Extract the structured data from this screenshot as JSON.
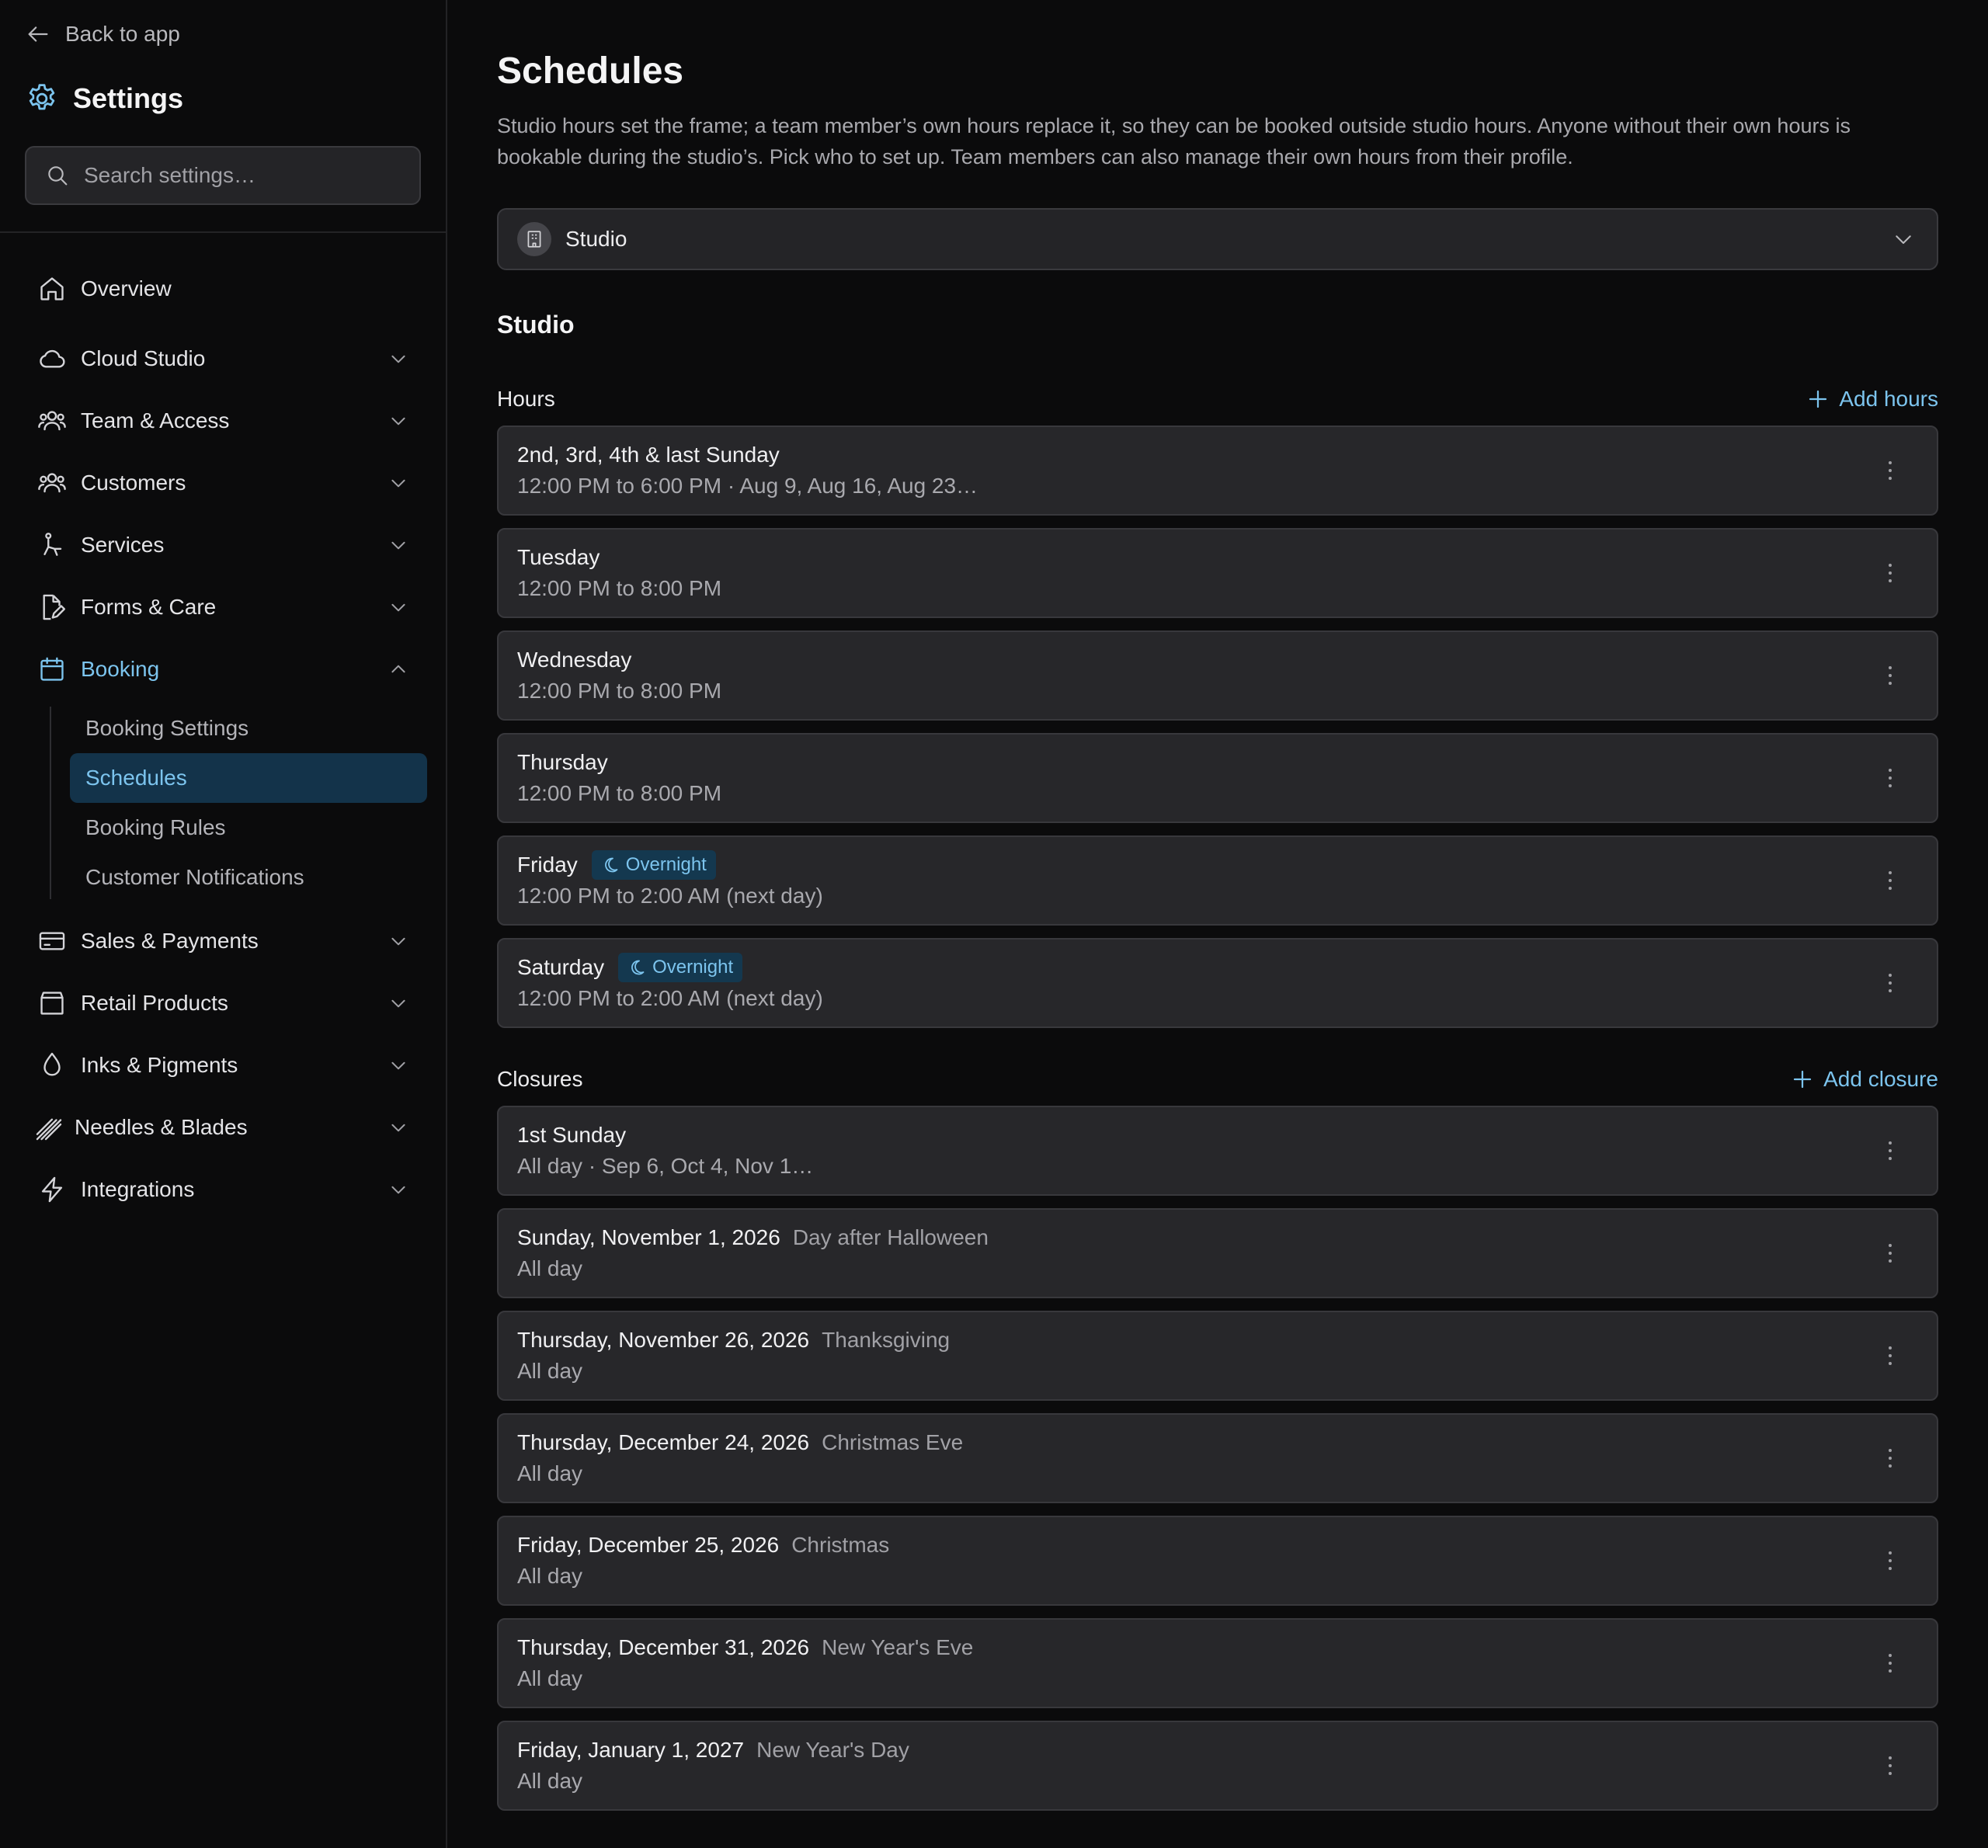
{
  "sidebar": {
    "back_label": "Back to app",
    "title": "Settings",
    "search_placeholder": "Search settings…",
    "nav": [
      {
        "label": "Overview",
        "icon": "home-icon"
      },
      {
        "label": "Cloud Studio",
        "icon": "cloud-icon"
      },
      {
        "label": "Team & Access",
        "icon": "team-icon"
      },
      {
        "label": "Customers",
        "icon": "customers-icon"
      },
      {
        "label": "Services",
        "icon": "services-icon"
      },
      {
        "label": "Forms & Care",
        "icon": "forms-icon"
      },
      {
        "label": "Booking",
        "icon": "calendar-icon",
        "expanded": true
      },
      {
        "label": "Sales & Payments",
        "icon": "card-icon"
      },
      {
        "label": "Retail Products",
        "icon": "bag-icon"
      },
      {
        "label": "Inks & Pigments",
        "icon": "drop-icon"
      },
      {
        "label": "Needles & Blades",
        "icon": "needles-icon"
      },
      {
        "label": "Integrations",
        "icon": "bolt-icon"
      }
    ],
    "booking_sub": [
      {
        "label": "Booking Settings"
      },
      {
        "label": "Schedules",
        "active": true
      },
      {
        "label": "Booking Rules"
      },
      {
        "label": "Customer Notifications"
      }
    ]
  },
  "main": {
    "title": "Schedules",
    "description": "Studio hours set the frame; a team member’s own hours replace it, so they can be booked outside studio hours. Anyone without their own hours is bookable during the studio’s. Pick who to set up. Team members can also manage their own hours from their profile.",
    "selector_value": "Studio",
    "section_title": "Studio",
    "hours": {
      "label": "Hours",
      "add_label": "Add hours",
      "items": [
        {
          "title": "2nd, 3rd, 4th & last Sunday",
          "detail": "12:00 PM to 6:00 PM · Aug 9, Aug 16, Aug 23…",
          "badge": ""
        },
        {
          "title": "Tuesday",
          "detail": "12:00 PM to 8:00 PM",
          "badge": ""
        },
        {
          "title": "Wednesday",
          "detail": "12:00 PM to 8:00 PM",
          "badge": ""
        },
        {
          "title": "Thursday",
          "detail": "12:00 PM to 8:00 PM",
          "badge": ""
        },
        {
          "title": "Friday",
          "detail": "12:00 PM to 2:00 AM (next day)",
          "badge": "Overnight"
        },
        {
          "title": "Saturday",
          "detail": "12:00 PM to 2:00 AM (next day)",
          "badge": "Overnight"
        }
      ]
    },
    "closures": {
      "label": "Closures",
      "add_label": "Add closure",
      "items": [
        {
          "title": "1st Sunday",
          "note": "",
          "detail": "All day · Sep 6, Oct 4, Nov 1…"
        },
        {
          "title": "Sunday, November 1, 2026",
          "note": "Day after Halloween",
          "detail": "All day"
        },
        {
          "title": "Thursday, November 26, 2026",
          "note": "Thanksgiving",
          "detail": "All day"
        },
        {
          "title": "Thursday, December 24, 2026",
          "note": "Christmas Eve",
          "detail": "All day"
        },
        {
          "title": "Friday, December 25, 2026",
          "note": "Christmas",
          "detail": "All day"
        },
        {
          "title": "Thursday, December 31, 2026",
          "note": "New Year's Eve",
          "detail": "All day"
        },
        {
          "title": "Friday, January 1, 2027",
          "note": "New Year's Day",
          "detail": "All day"
        }
      ]
    }
  },
  "colors": {
    "accent": "#7cc4ee",
    "active_bg": "#13334a",
    "card_bg": "#27272a",
    "page_bg": "#0b0b0c"
  }
}
